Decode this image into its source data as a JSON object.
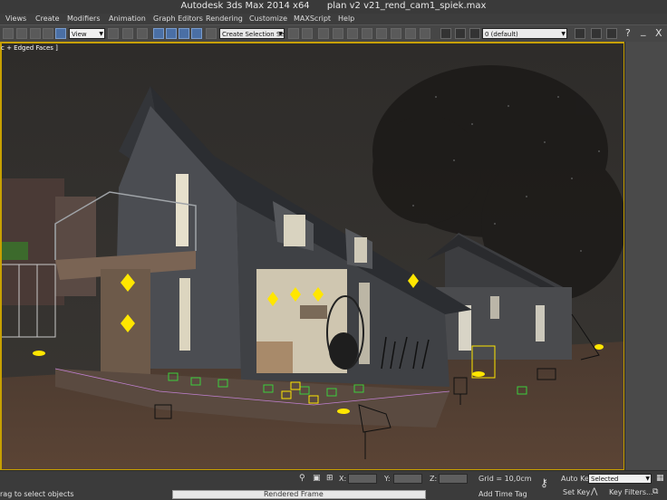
{
  "window": {
    "app_title": "Autodesk 3ds Max  2014 x64",
    "file_title": "plan v2 v21_rend_cam1_spiek.max"
  },
  "menu": {
    "items": [
      "Views",
      "Create",
      "Modifiers",
      "Animation",
      "Graph Editors",
      "Rendering",
      "Customize",
      "MAXScript",
      "Help"
    ]
  },
  "toolbar": {
    "view_dropdown": "View",
    "selection_set_placeholder": "Create Selection Se",
    "layer_dropdown": "0 (default)",
    "window_buttons": [
      "?",
      "_",
      "X"
    ]
  },
  "viewport": {
    "label": "c + Edged Faces ]"
  },
  "statusbar": {
    "x_label": "X:",
    "y_label": "Y:",
    "z_label": "Z:",
    "grid": "Grid = 10,0cm",
    "add_time_tag": "Add Time Tag",
    "auto_key": "Auto Key",
    "selected": "Selected",
    "set_key": "Set Key",
    "key_filters": "Key Filters...",
    "prompt": "rag to select objects",
    "lower_panel": "Rendered Frame"
  },
  "colors": {
    "viewport_border": "#c7a000",
    "light_yellow": "#ffe600",
    "helper_green": "#3ccf3c"
  }
}
